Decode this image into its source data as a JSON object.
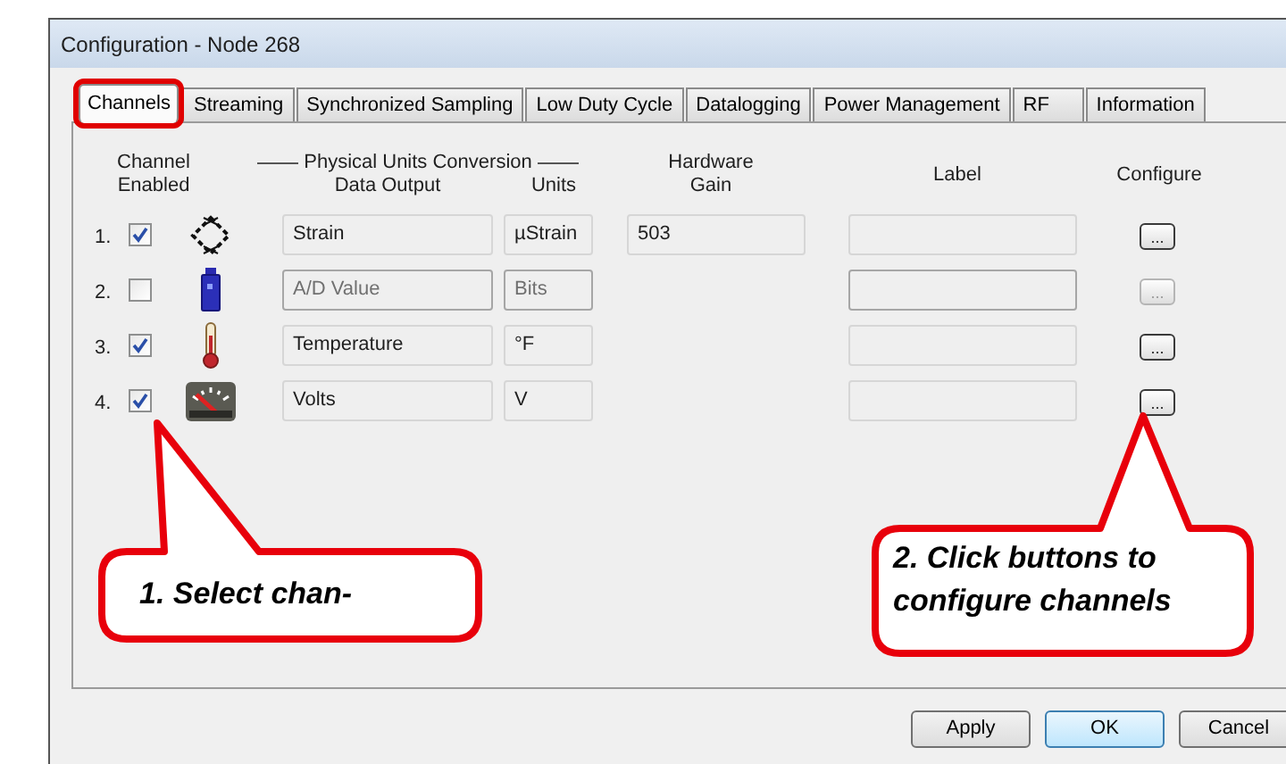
{
  "window": {
    "title": "Configuration - Node 268"
  },
  "tabs": [
    {
      "label": "Channels",
      "selected": true,
      "highlighted": true
    },
    {
      "label": "Streaming",
      "selected": false,
      "highlighted": false
    },
    {
      "label": "Synchronized Sampling",
      "selected": false,
      "highlighted": false
    },
    {
      "label": "Low Duty Cycle",
      "selected": false,
      "highlighted": false
    },
    {
      "label": "Datalogging",
      "selected": false,
      "highlighted": false
    },
    {
      "label": "Power Management",
      "selected": false,
      "highlighted": false
    },
    {
      "label": "RF",
      "selected": false,
      "highlighted": false
    },
    {
      "label": "Information",
      "selected": false,
      "highlighted": false
    }
  ],
  "headers": {
    "channel_enabled": "Channel Enabled",
    "group": "Physical Units Conversion",
    "data_output": "Data Output",
    "units": "Units",
    "hardware_gain": "Hardware Gain",
    "label": "Label",
    "configure": "Configure"
  },
  "channels": [
    {
      "number": "1.",
      "enabled": true,
      "kind": "strain",
      "data_output": "Strain",
      "units": "µStrain",
      "gain": "503",
      "configure": "..."
    },
    {
      "number": "2.",
      "enabled": false,
      "kind": "adc",
      "data_output": "A/D Value",
      "units": "Bits",
      "configure": "..."
    },
    {
      "number": "3.",
      "enabled": true,
      "kind": "temperature",
      "data_output": "Temperature",
      "units": "°F",
      "configure": "..."
    },
    {
      "number": "4.",
      "enabled": true,
      "kind": "volts",
      "data_output": "Volts",
      "units": "V",
      "configure": "..."
    }
  ],
  "buttons": [
    {
      "label": "Apply",
      "default": false
    },
    {
      "label": "OK",
      "default": true
    },
    {
      "label": "Cancel",
      "default": false
    }
  ],
  "callouts": [
    {
      "text": "1.  Select chan-"
    },
    {
      "text": "2.  Click buttons to configure channels"
    }
  ]
}
